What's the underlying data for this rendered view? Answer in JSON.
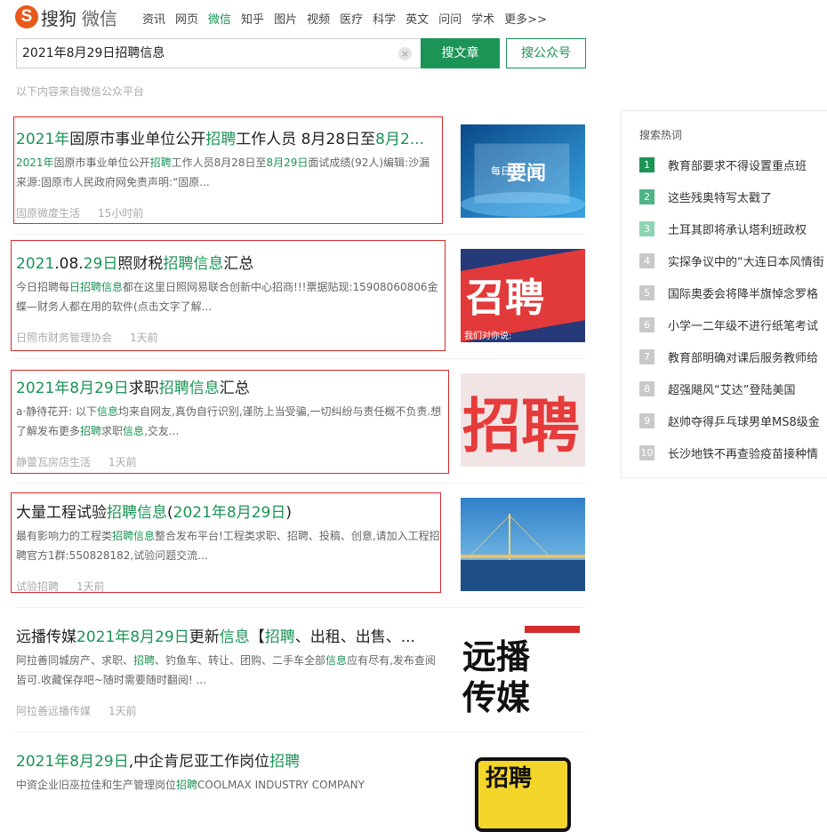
{
  "brand": {
    "logo_letter": "S",
    "name": "搜狗",
    "product": "微信"
  },
  "nav": [
    "资讯",
    "网页",
    "微信",
    "知乎",
    "图片",
    "视频",
    "医疗",
    "科学",
    "英文",
    "问问",
    "学术",
    "更多>>"
  ],
  "nav_active": "微信",
  "search": {
    "query": "2021年8月29日招聘信息",
    "clear_icon": "×",
    "btn_article": "搜文章",
    "btn_account": "搜公众号"
  },
  "source_note": "以下内容来自微信公众平台",
  "results": [
    {
      "title": [
        [
          "2021年",
          true
        ],
        [
          "固原市事业单位公开",
          false
        ],
        [
          "招聘",
          true
        ],
        [
          "工作人员 8月28日至",
          false
        ],
        [
          "8月2...",
          true
        ]
      ],
      "summary": [
        [
          "2021年",
          true
        ],
        [
          "固原市事业单位公开",
          false
        ],
        [
          "招聘",
          true
        ],
        [
          "工作人员8月28日至",
          false
        ],
        [
          "8月29日",
          true
        ],
        [
          "面试成绩(92人)编辑:沙漏 来源:固原市人民政府网免责声明:“固原...",
          false
        ]
      ],
      "source": "固原微度生活",
      "time": "15小时前",
      "thumb": "news"
    },
    {
      "title": [
        [
          "2021",
          true
        ],
        [
          ".08.",
          false
        ],
        [
          "29日",
          true
        ],
        [
          "照财税",
          false
        ],
        [
          "招聘信息",
          true
        ],
        [
          "汇总",
          false
        ]
      ],
      "summary": [
        [
          "今日招聘每",
          false
        ],
        [
          "日招聘信息",
          true
        ],
        [
          "都在这里日照网易联合创新中心招商!!!票据贴现:15908060806金蝶—财务人都在用的软件(点击文字了解...",
          false
        ]
      ],
      "source": "日照市财务管理协会",
      "time": "1天前",
      "thumb": "zhaopin1"
    },
    {
      "title": [
        [
          "2021年8月29日",
          true
        ],
        [
          "求职",
          false
        ],
        [
          "招聘信息",
          true
        ],
        [
          "汇总",
          false
        ]
      ],
      "summary": [
        [
          "a·静待花开: 以下",
          false
        ],
        [
          "信息",
          true
        ],
        [
          "均来自网友,真伪自行识别,谨防上当受骗,一切纠纷与责任概不负责.想了解发布更多",
          false
        ],
        [
          "招聘",
          true
        ],
        [
          "求职",
          false
        ],
        [
          "信息",
          true
        ],
        [
          ",交友...",
          false
        ]
      ],
      "source": "静蕾瓦房店生活",
      "time": "1天前",
      "thumb": "zhaopin2"
    },
    {
      "title": [
        [
          "大量工程试验",
          false
        ],
        [
          "招聘信息",
          true
        ],
        [
          "(",
          false
        ],
        [
          "2021年8月29日",
          true
        ],
        [
          ")",
          false
        ]
      ],
      "summary": [
        [
          "最有影响力的工程类",
          false
        ],
        [
          "招聘信息",
          true
        ],
        [
          "整合发布平台!工程类求职、招聘、投稿、创意,请加入工程招聘官方1群:550828182,试验问题交流...",
          false
        ]
      ],
      "source": "试验招聘",
      "time": "1天前",
      "thumb": "bridge"
    },
    {
      "title": [
        [
          "远播传媒",
          false
        ],
        [
          "2021年8月29日",
          true
        ],
        [
          "更新",
          false
        ],
        [
          "信息",
          true
        ],
        [
          "【",
          false
        ],
        [
          "招聘",
          true
        ],
        [
          "、出租、出售、...",
          false
        ]
      ],
      "summary": [
        [
          "阿拉善同城房产、求职、",
          false
        ],
        [
          "招聘",
          true
        ],
        [
          "、钓鱼车、转让、团购、二手车全部",
          false
        ],
        [
          "信息",
          true
        ],
        [
          "应有尽有,发布查阅皆可.收藏保存吧~随时需要随时翻阅! ...",
          false
        ]
      ],
      "source": "阿拉善远播传媒",
      "time": "1天前",
      "thumb": "yuanbo"
    },
    {
      "title": [
        [
          "2021年8月29日",
          true
        ],
        [
          ",中企肯尼亚工作岗位",
          false
        ],
        [
          "招聘",
          true
        ]
      ],
      "summary": [
        [
          "中资企业旧巫拉佳和生产管理岗位",
          false
        ],
        [
          "招聘",
          true
        ],
        [
          "COOLMAX INDUSTRY COMPANY",
          false
        ]
      ],
      "source": "",
      "time": "",
      "thumb": "zhaopin3"
    }
  ],
  "thumb_texts": {
    "news_a": "每日",
    "news_b": "要闻",
    "zp1": "召聘",
    "zp1_sub": "我们对你说:",
    "zp2": "招聘",
    "yb_top": "远播",
    "yb_bottom": "传媒",
    "zp3": "招聘"
  },
  "hot": {
    "title": "搜索热词",
    "colors": [
      "#1b9456",
      "#4fb488",
      "#8fd3b3",
      "#c9c9c9"
    ],
    "items": [
      "教育部要求不得设置重点班",
      "这些残奥特写太戳了",
      "土耳其即将承认塔利班政权",
      "实探争议中的“大连日本风情街",
      "国际奥委会将降半旗悼念罗格",
      "小学一二年级不进行纸笔考试",
      "教育部明确对课后服务教师给",
      "超强飓风“艾达”登陆美国",
      "赵帅夺得乒乓球男单MS8级金",
      "长沙地铁不再查验疫苗接种情"
    ]
  }
}
